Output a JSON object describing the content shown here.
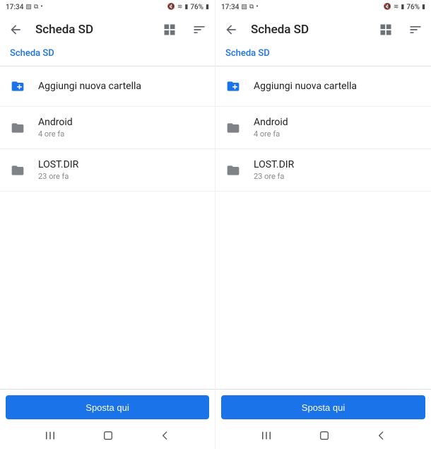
{
  "status": {
    "time": "17:34",
    "battery_pct": "76%"
  },
  "appbar": {
    "title": "Scheda SD"
  },
  "breadcrumb": {
    "path": "Scheda SD"
  },
  "list": {
    "add_folder": "Aggiungi nuova cartella",
    "items": [
      {
        "name": "Android",
        "sub": "4 ore fa"
      },
      {
        "name": "LOST.DIR",
        "sub": "23 ore fa"
      }
    ]
  },
  "bottom": {
    "button_label": "Sposta qui"
  }
}
